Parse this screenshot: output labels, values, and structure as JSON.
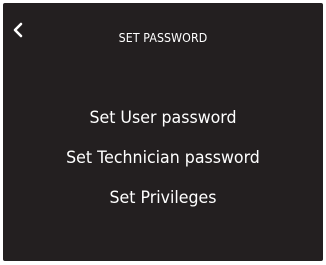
{
  "header": {
    "back_icon": "chevron-left-icon",
    "title": "SET PASSWORD"
  },
  "menu": {
    "items": [
      {
        "label": "Set User password"
      },
      {
        "label": "Set Technician password"
      },
      {
        "label": "Set Privileges"
      }
    ]
  },
  "colors": {
    "background": "#231f20",
    "text": "#ffffff"
  }
}
